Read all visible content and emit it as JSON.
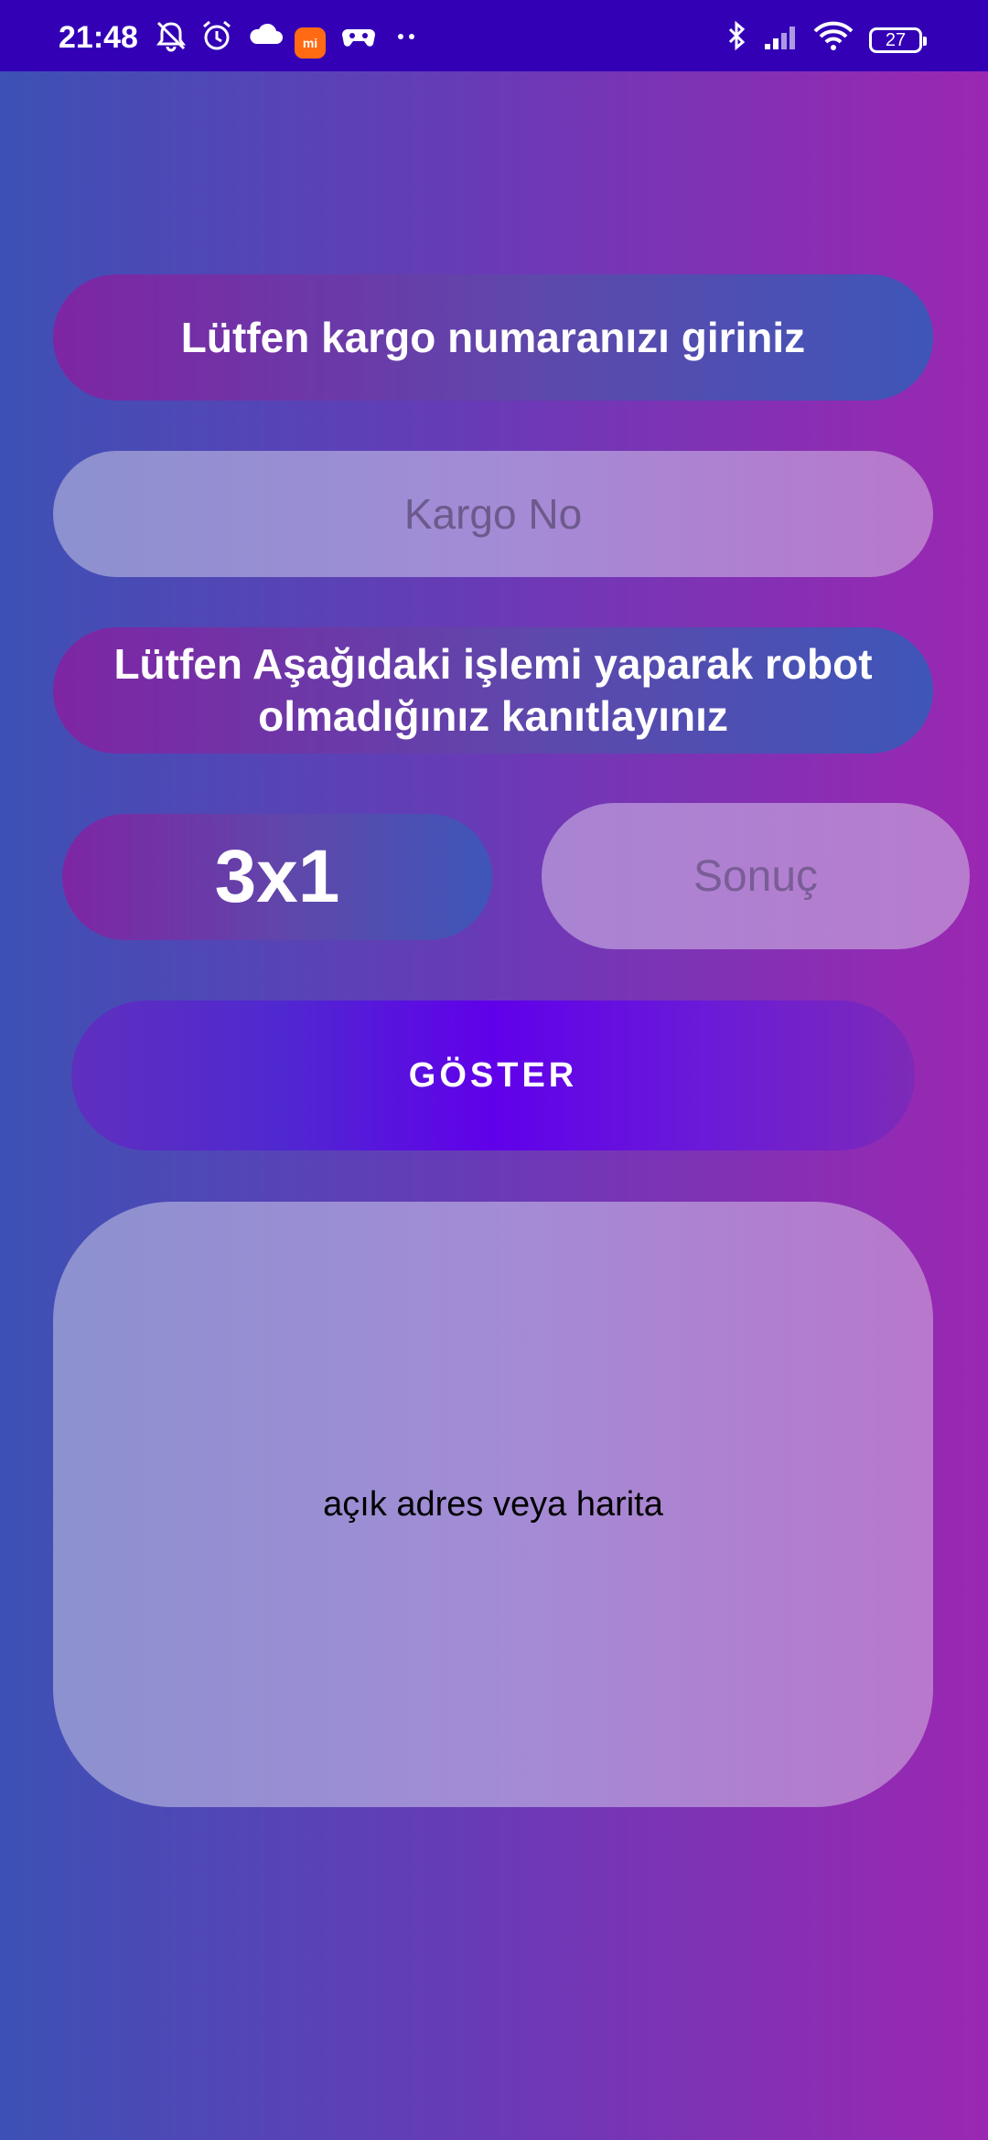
{
  "status_bar": {
    "time": "21:48",
    "battery": "27",
    "icons": [
      "mute-vibrate-icon",
      "alarm-icon",
      "cloud-icon",
      "mi-store-icon",
      "game-controller-icon",
      "more-dots-icon",
      "bluetooth-icon",
      "signal-icon",
      "wifi-icon",
      "battery-icon"
    ],
    "mi_label": "mi"
  },
  "form": {
    "title": "Lütfen kargo numaranızı giriniz",
    "cargo_placeholder": "Kargo No",
    "captcha_instruction": "Lütfen Aşağıdaki işlemi yaparak robot olmadığınız kanıtlayınız",
    "captcha_equation": "3x1",
    "result_placeholder": "Sonuç",
    "show_button_label": "GÖSTER"
  },
  "result_area": {
    "text": "açık adres veya harita"
  },
  "colors": {
    "status_bar": "#3300b6",
    "background_start": "#3d51b5",
    "background_end": "#9b27b2",
    "button": "#6000ea"
  }
}
